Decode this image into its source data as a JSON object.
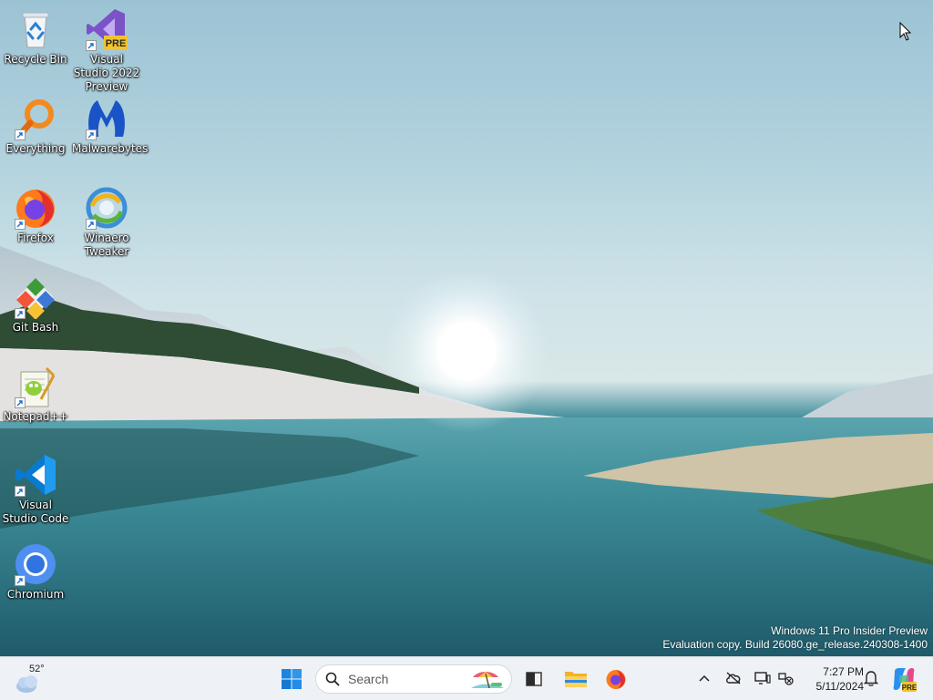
{
  "desktop": {
    "icons": [
      {
        "id": "recycle-bin",
        "label": "Recycle Bin"
      },
      {
        "id": "visual-studio-2022-preview",
        "label": "Visual Studio 2022 Preview",
        "badge": "PRE"
      },
      {
        "id": "everything",
        "label": "Everything"
      },
      {
        "id": "malwarebytes",
        "label": "Malwarebytes"
      },
      {
        "id": "firefox",
        "label": "Firefox"
      },
      {
        "id": "winaero-tweaker",
        "label": "Winaero Tweaker"
      },
      {
        "id": "git-bash",
        "label": "Git Bash"
      },
      {
        "id": "notepad-plus-plus",
        "label": "Notepad++"
      },
      {
        "id": "vscode",
        "label": "Visual Studio Code"
      },
      {
        "id": "chromium",
        "label": "Chromium"
      }
    ]
  },
  "watermark": {
    "line1": "Windows 11 Pro Insider Preview",
    "line2": "Evaluation copy. Build 26080.ge_release.240308-1400"
  },
  "taskbar": {
    "weather_temp": "52°",
    "search_placeholder": "Search",
    "pinned": [
      "start-button",
      "search",
      "task-view",
      "file-explorer",
      "firefox"
    ],
    "tray_icons": [
      "chevron-up-icon",
      "onedrive-offline-icon",
      "display-icon",
      "network-icon"
    ],
    "clock_time": "7:27 PM",
    "clock_date": "5/11/2024",
    "copilot_badge": "PRE"
  },
  "colors": {
    "taskbar_bg": "#eef1f5",
    "accent": "#0078d4"
  }
}
